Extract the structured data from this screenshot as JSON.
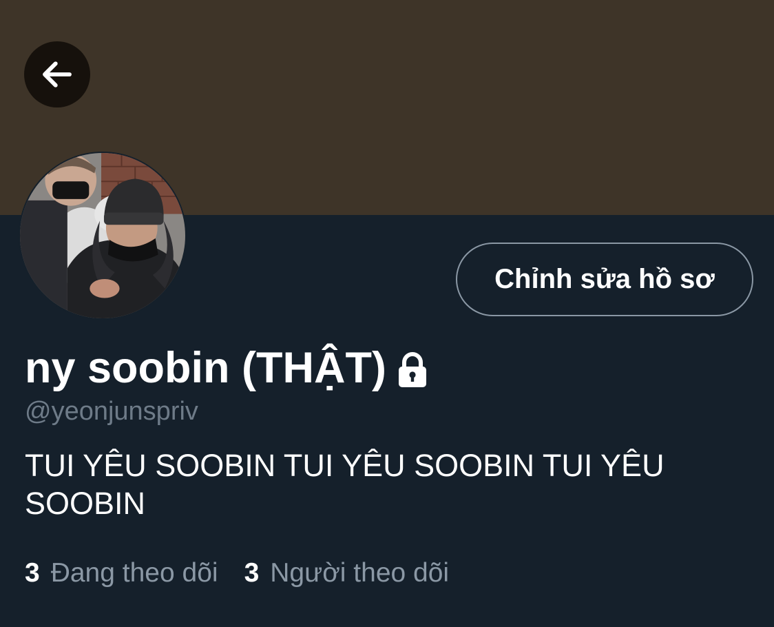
{
  "header": {
    "back_icon": "arrow-left-icon",
    "banner_color": "#3e3428"
  },
  "profile": {
    "avatar": "avatar-photo",
    "edit_button_label": "Chỉnh sửa hồ sơ",
    "display_name": "ny soobin (THẬT)",
    "protected_icon": "lock-icon",
    "handle": "@yeonjunspriv",
    "bio": "TUI YÊU SOOBIN TUI YÊU SOOBIN TUI YÊU SOOBIN"
  },
  "stats": {
    "following_count": "3",
    "following_label": "Đang theo dõi",
    "followers_count": "3",
    "followers_label": "Người theo dõi"
  },
  "colors": {
    "background": "#15202b",
    "text_primary": "#ffffff",
    "text_secondary": "#8b98a5"
  }
}
